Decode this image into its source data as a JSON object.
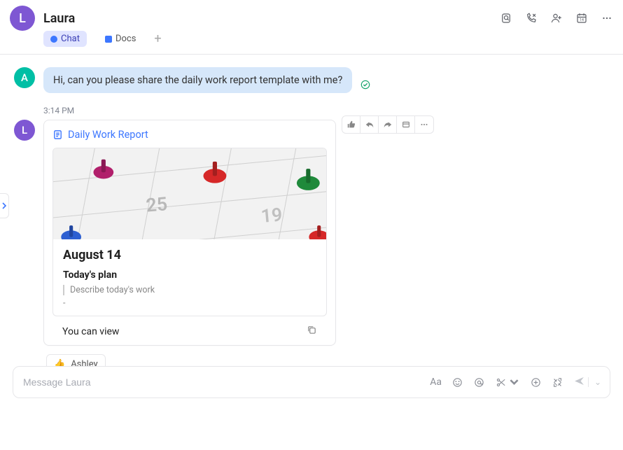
{
  "header": {
    "avatar_letter": "L",
    "title": "Laura"
  },
  "tabs": {
    "chat": "Chat",
    "docs": "Docs"
  },
  "msg1": {
    "avatar": "A",
    "text": "Hi, can you please share the daily work report template with me?"
  },
  "timestamp": "3:14 PM",
  "doc": {
    "avatar": "L",
    "title": "Daily Work Report",
    "date": "August 14",
    "subtitle": "Today's plan",
    "placeholder": "Describe today's work",
    "dash": "-",
    "permission": "You can view"
  },
  "reaction": {
    "emoji": "👍",
    "name": "Ashley"
  },
  "composer": {
    "placeholder": "Message Laura"
  },
  "text_format_label": "Aa"
}
